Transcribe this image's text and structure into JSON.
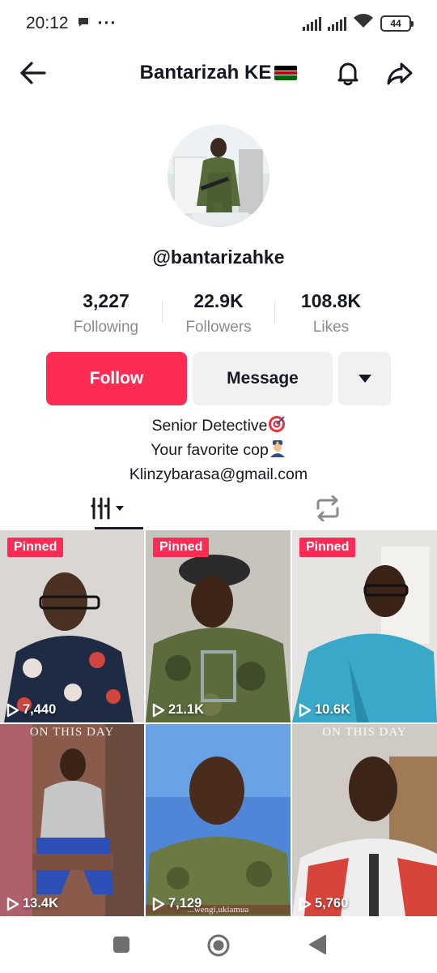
{
  "status_bar": {
    "time": "20:12",
    "battery": "44"
  },
  "header": {
    "title": "Bantarizah KE"
  },
  "profile": {
    "username": "@bantarizahke",
    "stats": [
      {
        "value": "3,227",
        "label": "Following"
      },
      {
        "value": "22.9K",
        "label": "Followers"
      },
      {
        "value": "108.8K",
        "label": "Likes"
      }
    ],
    "follow_label": "Follow",
    "message_label": "Message",
    "bio": {
      "line1": "Senior Detective",
      "line2": "Your favorite cop",
      "line3": "Klinzybarasa@gmail.com"
    }
  },
  "videos": [
    {
      "pinned": "Pinned",
      "views": "7,440"
    },
    {
      "pinned": "Pinned",
      "views": "21.1K"
    },
    {
      "pinned": "Pinned",
      "views": "10.6K"
    },
    {
      "overlay": "ON THIS DAY",
      "views": "13.4K"
    },
    {
      "caption": "...wengi,ukiamua",
      "views": "7,129"
    },
    {
      "overlay": "ON THIS DAY",
      "views": "5,760"
    }
  ],
  "colors": {
    "accent": "#fe2c55",
    "secondary_button": "#f1f1f2",
    "muted_text": "#8a8b91"
  }
}
